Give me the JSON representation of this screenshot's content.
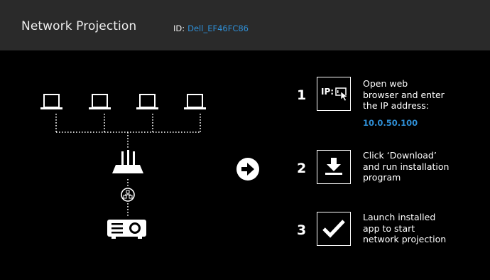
{
  "header": {
    "title": "Network Projection",
    "id_label": "ID:",
    "id_value": "Dell_EF46FC86"
  },
  "colors": {
    "header_bg": "#2a2a2a",
    "background": "#000000",
    "accent": "#2f8fd6",
    "foreground": "#ffffff"
  },
  "diagram": {
    "laptop_count": 4,
    "icons": [
      "laptop-icon",
      "router-icon",
      "network-connector-icon",
      "projector-icon"
    ]
  },
  "arrow_icon": "arrow-right-circle-icon",
  "steps": [
    {
      "number": "1",
      "icon": "ip-cursor-icon",
      "icon_label": "IP:",
      "text": [
        "Open web",
        "browser and enter",
        "the IP address:"
      ],
      "value": "10.0.50.100"
    },
    {
      "number": "2",
      "icon": "download-icon",
      "text": [
        "Click ‘Download’",
        "and run installation",
        "program"
      ]
    },
    {
      "number": "3",
      "icon": "checkmark-icon",
      "text": [
        "Launch installed",
        "app to start",
        "network projection"
      ]
    }
  ]
}
